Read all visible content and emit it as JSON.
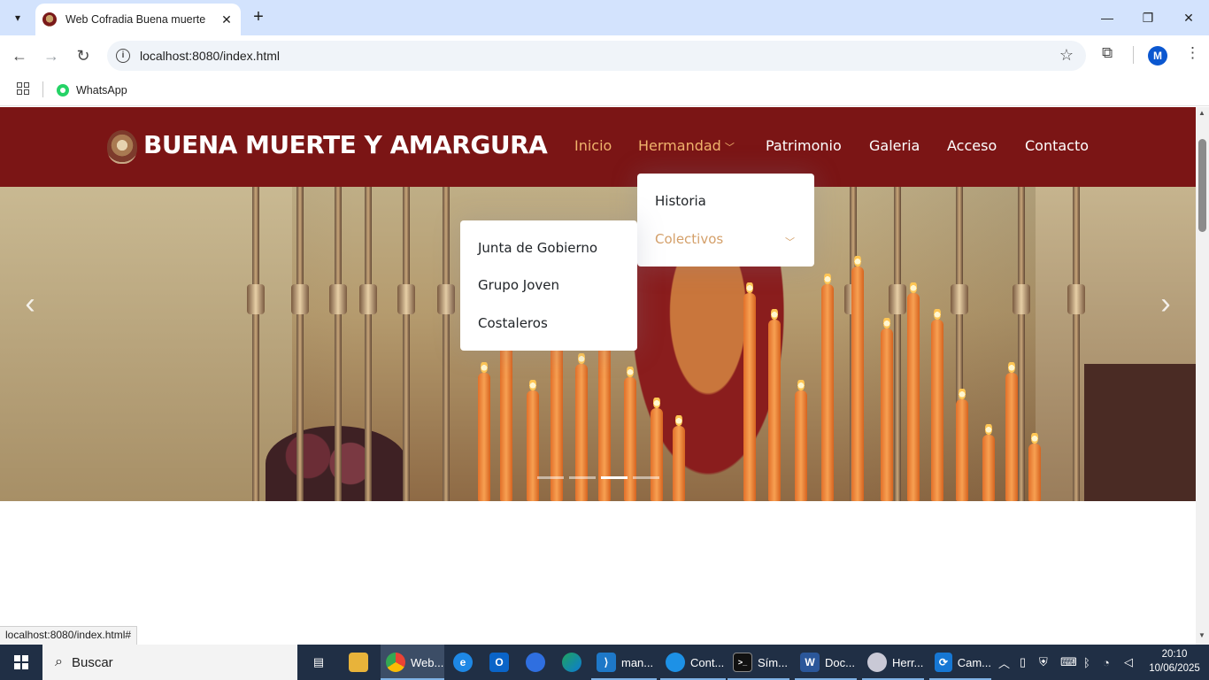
{
  "browser": {
    "tab_title": "Web Cofradia Buena muerte",
    "url": "localhost:8080/index.html",
    "bookmark_whatsapp": "WhatsApp",
    "profile_initial": "M",
    "status_url": "localhost:8080/index.html#"
  },
  "site": {
    "brand": "BUENA MUERTE Y AMARGURA",
    "nav": {
      "inicio": "Inicio",
      "hermandad": "Hermandad",
      "patrimonio": "Patrimonio",
      "galeria": "Galeria",
      "acceso": "Acceso",
      "contacto": "Contacto"
    },
    "dropdown_hermandad": {
      "historia": "Historia",
      "colectivos": "Colectivos"
    },
    "dropdown_colectivos": {
      "junta": "Junta de Gobierno",
      "grupo_joven": "Grupo Joven",
      "costaleros": "Costaleros"
    },
    "carousel": {
      "slide_count": 4,
      "active_slide": 3
    },
    "colors": {
      "header_bg": "#7b1515",
      "accent": "#f0b36c"
    }
  },
  "taskbar": {
    "search_placeholder": "Buscar",
    "items": {
      "chrome": "Web...",
      "vscode": "man...",
      "docker": "Cont...",
      "terminal": "Sím...",
      "word": "Doc...",
      "tool": "Herr...",
      "cam": "Cam..."
    },
    "time": "20:10",
    "date": "10/06/2025"
  }
}
